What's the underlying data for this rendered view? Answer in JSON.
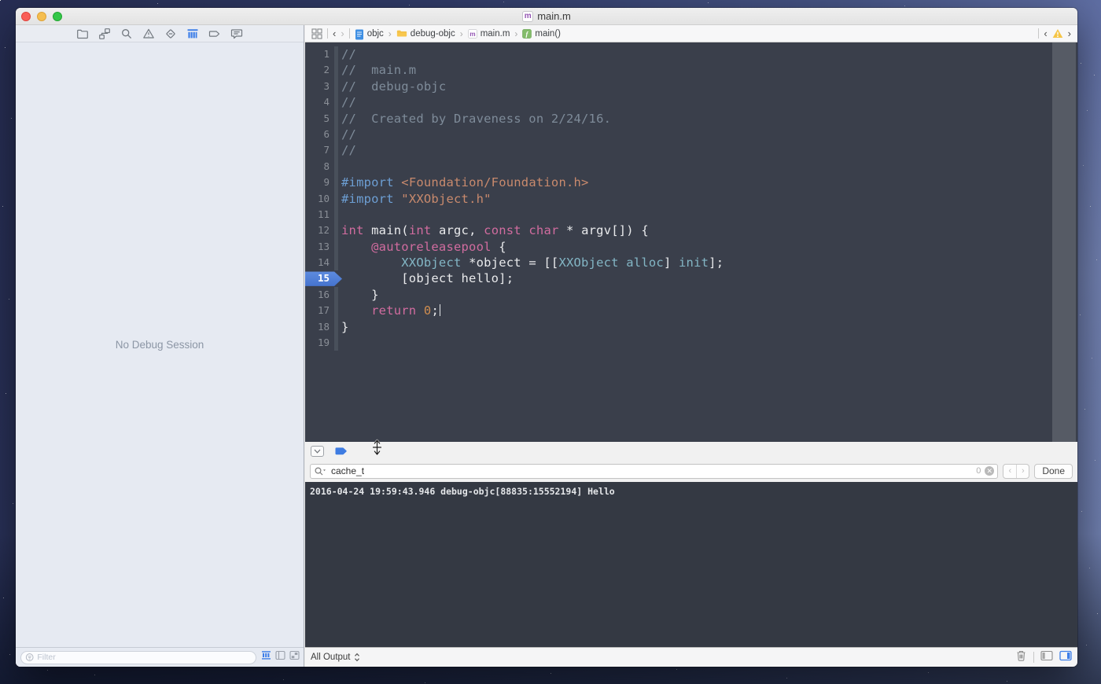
{
  "colors": {
    "accent_blue": "#3D7EE8",
    "breakpoint_blue": "#4D7ED8",
    "editor_bg": "#3A3F4B",
    "console_bg": "#343943",
    "sidebar_bg": "#E6EAF2",
    "warning_yellow": "#F5C546",
    "syntax": {
      "comment": "#7E8B99",
      "kw": "#D16C9F",
      "pre": "#6D9FD4",
      "str": "#C98A6D",
      "type": "#83B6C5",
      "num": "#CE8C4F",
      "plain": "#E9EAEC"
    }
  },
  "titlebar": {
    "title": "main.m"
  },
  "navigator": {
    "empty_text": "No Debug Session",
    "filter_placeholder": "Filter"
  },
  "jump_bar": {
    "crumbs": [
      "objc",
      "debug-objc",
      "main.m",
      "main()"
    ]
  },
  "editor": {
    "breakpoint_line": 15,
    "lines": [
      {
        "n": 1,
        "segments": [
          {
            "t": "//",
            "c": "comment"
          }
        ]
      },
      {
        "n": 2,
        "segments": [
          {
            "t": "//  main.m",
            "c": "comment"
          }
        ]
      },
      {
        "n": 3,
        "segments": [
          {
            "t": "//  debug-objc",
            "c": "comment"
          }
        ]
      },
      {
        "n": 4,
        "segments": [
          {
            "t": "//",
            "c": "comment"
          }
        ]
      },
      {
        "n": 5,
        "segments": [
          {
            "t": "//  Created by Draveness on 2/24/16.",
            "c": "comment"
          }
        ]
      },
      {
        "n": 6,
        "segments": [
          {
            "t": "//",
            "c": "comment"
          }
        ]
      },
      {
        "n": 7,
        "segments": [
          {
            "t": "//",
            "c": "comment"
          }
        ]
      },
      {
        "n": 8,
        "segments": []
      },
      {
        "n": 9,
        "segments": [
          {
            "t": "#import",
            "c": "pre"
          },
          {
            "t": " ",
            "c": "plain"
          },
          {
            "t": "<Foundation/Foundation.h>",
            "c": "str"
          }
        ]
      },
      {
        "n": 10,
        "segments": [
          {
            "t": "#import",
            "c": "pre"
          },
          {
            "t": " ",
            "c": "plain"
          },
          {
            "t": "\"XXObject.h\"",
            "c": "str"
          }
        ]
      },
      {
        "n": 11,
        "segments": []
      },
      {
        "n": 12,
        "segments": [
          {
            "t": "int",
            "c": "kw"
          },
          {
            "t": " main(",
            "c": "plain"
          },
          {
            "t": "int",
            "c": "kw"
          },
          {
            "t": " argc, ",
            "c": "plain"
          },
          {
            "t": "const",
            "c": "kw"
          },
          {
            "t": " ",
            "c": "plain"
          },
          {
            "t": "char",
            "c": "kw"
          },
          {
            "t": " * argv[]) {",
            "c": "plain"
          }
        ]
      },
      {
        "n": 13,
        "segments": [
          {
            "t": "    ",
            "c": "plain"
          },
          {
            "t": "@autoreleasepool",
            "c": "kw"
          },
          {
            "t": " {",
            "c": "plain"
          }
        ]
      },
      {
        "n": 14,
        "segments": [
          {
            "t": "        ",
            "c": "plain"
          },
          {
            "t": "XXObject",
            "c": "type"
          },
          {
            "t": " *object = [[",
            "c": "plain"
          },
          {
            "t": "XXObject",
            "c": "type"
          },
          {
            "t": " ",
            "c": "plain"
          },
          {
            "t": "alloc",
            "c": "type"
          },
          {
            "t": "] ",
            "c": "plain"
          },
          {
            "t": "init",
            "c": "type"
          },
          {
            "t": "];",
            "c": "plain"
          }
        ]
      },
      {
        "n": 15,
        "segments": [
          {
            "t": "        [object hello];",
            "c": "plain"
          }
        ]
      },
      {
        "n": 16,
        "segments": [
          {
            "t": "    }",
            "c": "plain"
          }
        ]
      },
      {
        "n": 17,
        "segments": [
          {
            "t": "    ",
            "c": "plain"
          },
          {
            "t": "return",
            "c": "kw"
          },
          {
            "t": " ",
            "c": "plain"
          },
          {
            "t": "0",
            "c": "num"
          },
          {
            "t": ";",
            "c": "plain"
          },
          {
            "t": "",
            "c": "caret"
          }
        ]
      },
      {
        "n": 18,
        "segments": [
          {
            "t": "}",
            "c": "plain"
          }
        ]
      },
      {
        "n": 19,
        "segments": []
      }
    ]
  },
  "debug_bar": {
    "filter_value": "cache_t",
    "match_count": "0",
    "done_label": "Done"
  },
  "console": {
    "log_line": "2016-04-24 19:59:43.946 debug-objc[88835:15552194] Hello",
    "output_filter_label": "All Output"
  }
}
